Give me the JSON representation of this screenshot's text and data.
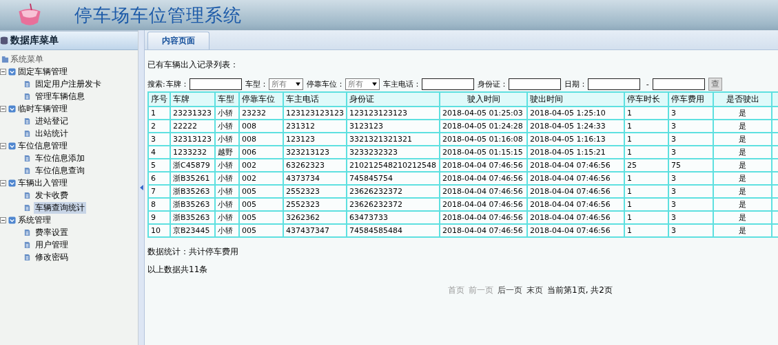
{
  "header": {
    "title": "停车场车位管理系统"
  },
  "sidebar": {
    "title": "数据库菜单",
    "root": "系统菜单",
    "groups": [
      {
        "label": "固定车辆管理",
        "expanded": true,
        "children": [
          {
            "label": "固定用户注册发卡",
            "selected": false
          },
          {
            "label": "管理车辆信息",
            "selected": false
          }
        ]
      },
      {
        "label": "临时车辆管理",
        "expanded": true,
        "children": [
          {
            "label": "进站登记",
            "selected": false
          },
          {
            "label": "出站统计",
            "selected": false
          }
        ]
      },
      {
        "label": "车位信息管理",
        "expanded": true,
        "children": [
          {
            "label": "车位信息添加",
            "selected": false
          },
          {
            "label": "车位信息查询",
            "selected": false
          }
        ]
      },
      {
        "label": "车辆出入管理",
        "expanded": true,
        "children": [
          {
            "label": "发卡收费",
            "selected": false
          },
          {
            "label": "车辆查询统计",
            "selected": true
          }
        ]
      },
      {
        "label": "系统管理",
        "expanded": true,
        "children": [
          {
            "label": "费率设置",
            "selected": false
          },
          {
            "label": "用户管理",
            "selected": false
          },
          {
            "label": "修改密码",
            "selected": false
          }
        ]
      }
    ]
  },
  "tabs": [
    {
      "label": "内容页面",
      "selected": true
    }
  ],
  "list_title": "已有车辆出入记录列表：",
  "search": {
    "label": "搜索:",
    "filters": [
      {
        "kind": "text",
        "label": "车牌："
      },
      {
        "kind": "select",
        "label": "车型：",
        "value": "所有"
      },
      {
        "kind": "select",
        "label": "停靠车位：",
        "value": "所有"
      },
      {
        "kind": "text",
        "label": "车主电话："
      },
      {
        "kind": "text",
        "label": "身份证："
      },
      {
        "kind": "range",
        "label": "日期：",
        "separator": "-"
      }
    ],
    "button": "查"
  },
  "table": {
    "columns": [
      "序号",
      "车牌",
      "车型",
      "停靠车位",
      "车主电话",
      "身份证",
      "驶入时间",
      "驶出时间",
      "停车时长",
      "停车费用",
      "是否驶出",
      ""
    ],
    "rows": [
      [
        "1",
        "23231323",
        "小轿",
        "23232",
        "123123123123",
        "123123123123",
        "2018-04-05 01:25:03",
        "2018-04-05 1:25:10",
        "1",
        "3",
        "是"
      ],
      [
        "2",
        "22222",
        "小轿",
        "008",
        "231312",
        "3123123",
        "2018-04-05 01:24:28",
        "2018-04-05 1:24:33",
        "1",
        "3",
        "是"
      ],
      [
        "3",
        "32313123",
        "小轿",
        "008",
        "123123",
        "3321321321321",
        "2018-04-05 01:16:08",
        "2018-04-05 1:16:13",
        "1",
        "3",
        "是"
      ],
      [
        "4",
        "1233232",
        "越野",
        "006",
        "323213123",
        "3233232323",
        "2018-04-05 01:15:15",
        "2018-04-05 1:15:21",
        "1",
        "3",
        "是"
      ],
      [
        "5",
        "浙C45879",
        "小轿",
        "002",
        "63262323",
        "210212548210212548",
        "2018-04-04 07:46:56",
        "2018-04-04 07:46:56",
        "25",
        "75",
        "是"
      ],
      [
        "6",
        "浙B35261",
        "小轿",
        "002",
        "4373734",
        "745845754",
        "2018-04-04 07:46:56",
        "2018-04-04 07:46:56",
        "1",
        "3",
        "是"
      ],
      [
        "7",
        "浙B35263",
        "小轿",
        "005",
        "2552323",
        "23626232372",
        "2018-04-04 07:46:56",
        "2018-04-04 07:46:56",
        "1",
        "3",
        "是"
      ],
      [
        "8",
        "浙B35263",
        "小轿",
        "005",
        "2552323",
        "23626232372",
        "2018-04-04 07:46:56",
        "2018-04-04 07:46:56",
        "1",
        "3",
        "是"
      ],
      [
        "9",
        "浙B35263",
        "小轿",
        "005",
        "3262362",
        "63473733",
        "2018-04-04 07:46:56",
        "2018-04-04 07:46:56",
        "1",
        "3",
        "是"
      ],
      [
        "10",
        "京B23445",
        "小轿",
        "005",
        "437437347",
        "74584585484",
        "2018-04-04 07:46:56",
        "2018-04-04 07:46:56",
        "1",
        "3",
        "是"
      ]
    ]
  },
  "stats": "数据统计：共计停车费用",
  "total": "以上数据共11条",
  "pager": {
    "links": [
      {
        "label": "首页",
        "disabled": true
      },
      {
        "label": "前一页",
        "disabled": true
      },
      {
        "label": "后一页",
        "disabled": false
      },
      {
        "label": "末页",
        "disabled": false
      }
    ],
    "status": "当前第1页, 共2页"
  }
}
